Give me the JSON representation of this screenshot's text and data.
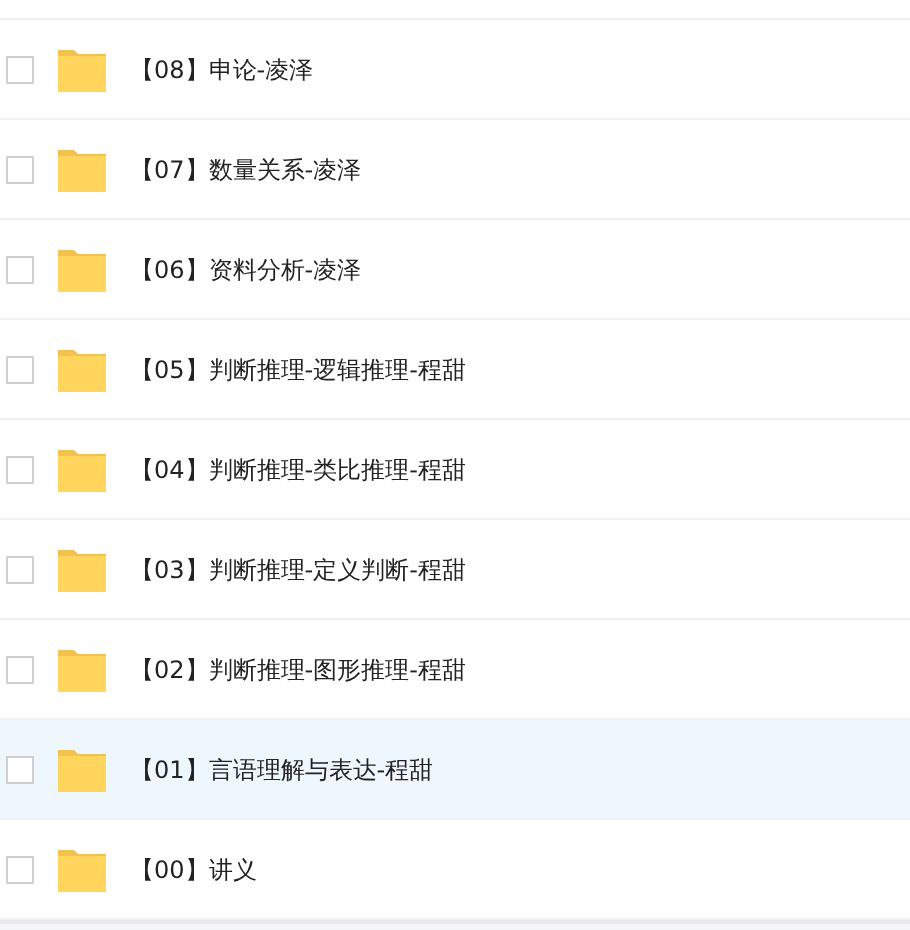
{
  "files": [
    {
      "name": "【08】申论-凌泽",
      "checked": false,
      "selected": false
    },
    {
      "name": "【07】数量关系-凌泽",
      "checked": false,
      "selected": false
    },
    {
      "name": "【06】资料分析-凌泽",
      "checked": false,
      "selected": false
    },
    {
      "name": "【05】判断推理-逻辑推理-程甜",
      "checked": false,
      "selected": false
    },
    {
      "name": "【04】判断推理-类比推理-程甜",
      "checked": false,
      "selected": false
    },
    {
      "name": "【03】判断推理-定义判断-程甜",
      "checked": false,
      "selected": false
    },
    {
      "name": "【02】判断推理-图形推理-程甜",
      "checked": false,
      "selected": false
    },
    {
      "name": "【01】言语理解与表达-程甜",
      "checked": false,
      "selected": true
    },
    {
      "name": "【00】讲义",
      "checked": false,
      "selected": false
    }
  ]
}
